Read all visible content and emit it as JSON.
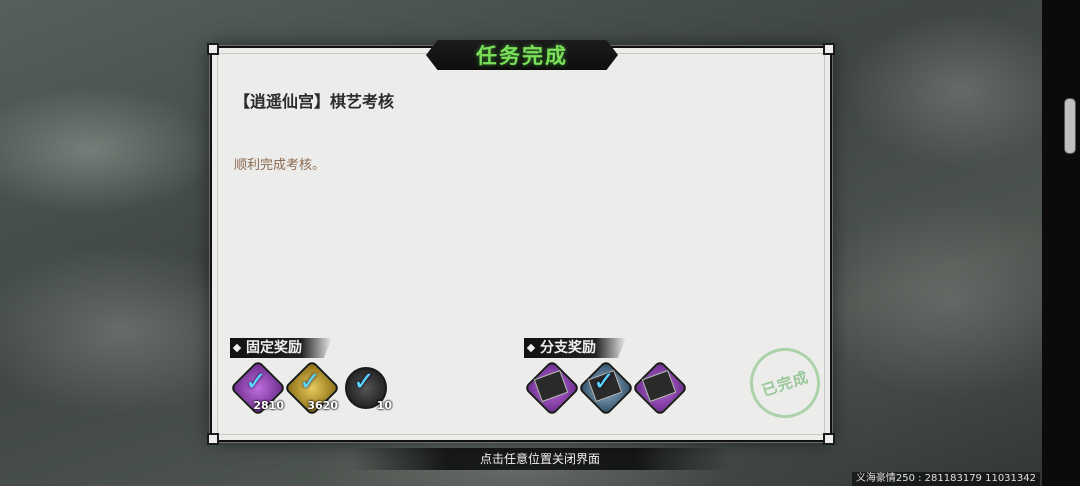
{
  "dialog": {
    "title": "任务完成",
    "quest_title": "【逍遥仙宫】棋艺考核",
    "quest_desc": "顺利完成考核。",
    "fixed_rewards_label": "固定奖励",
    "branch_rewards_label": "分支奖励",
    "fixed_rewards": [
      {
        "icon": "purple-orb-icon",
        "count": "2810"
      },
      {
        "icon": "gold-orb-icon",
        "count": "3620"
      },
      {
        "icon": "ink-scroll-icon",
        "count": "10"
      }
    ],
    "branch_rewards": [
      {
        "icon": "purple-book-icon"
      },
      {
        "icon": "blue-book-icon"
      },
      {
        "icon": "purple-book-icon"
      }
    ],
    "completed_stamp": "已完成"
  },
  "close_hint": "点击任意位置关闭界面",
  "footer_id": "义海豪情250 : 281183179 11031342",
  "colors": {
    "title_green": "#7be05a",
    "check_cyan": "#5ad8ff",
    "desc_brown": "#8a6a50"
  }
}
